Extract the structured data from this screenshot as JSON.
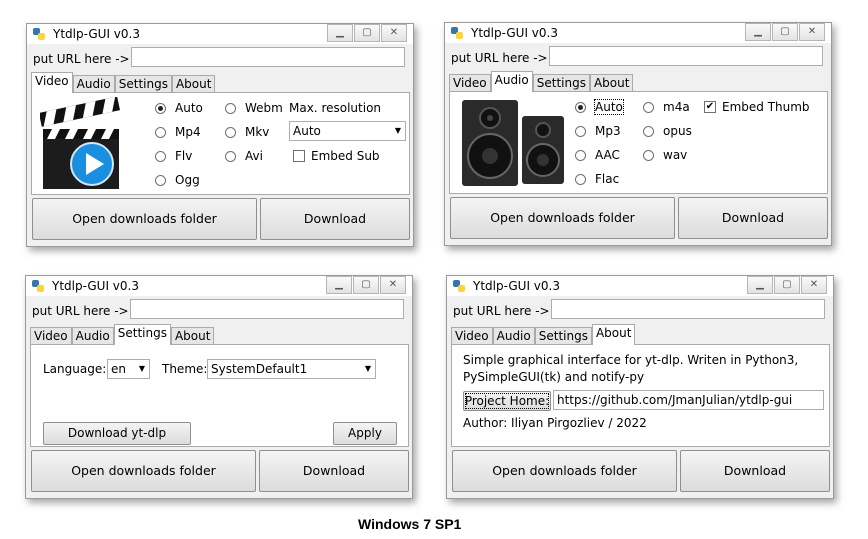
{
  "caption": "Windows 7 SP1",
  "window": {
    "title": "Ytdlp-GUI v0.3",
    "url_label": "put URL here ->",
    "url_value": "",
    "tabs": [
      "Video",
      "Audio",
      "Settings",
      "About"
    ],
    "open_folder_label": "Open downloads folder",
    "download_label": "Download"
  },
  "video": {
    "radios": [
      "Auto",
      "Mp4",
      "Flv",
      "Ogg",
      "Webm",
      "Mkv",
      "Avi"
    ],
    "selected": "Auto",
    "max_resolution_label": "Max. resolution",
    "max_resolution_value": "Auto",
    "embed_sub_label": "Embed Sub",
    "embed_sub_checked": false
  },
  "audio": {
    "radios": [
      "Auto",
      "Mp3",
      "AAC",
      "Flac",
      "m4a",
      "opus",
      "wav"
    ],
    "selected": "Auto",
    "embed_thumb_label": "Embed Thumb",
    "embed_thumb_checked": true,
    "check_mark": "✔"
  },
  "settings": {
    "language_label": "Language:",
    "language_value": "en",
    "theme_label": "Theme:",
    "theme_value": "SystemDefault1",
    "download_ytdlp_label": "Download yt-dlp",
    "apply_label": "Apply"
  },
  "about": {
    "line1": "Simple graphical interface for yt-dlp. Writen in Python3,",
    "line2": "PySimpleGUI(tk) and notify-py",
    "project_home_label": "Project Home:",
    "project_url": "https://github.com/JmanJulian/ytdlp-gui",
    "author": "Author: Iliyan Pirgozliev / 2022"
  },
  "colors": {
    "accent_blue": "#1a8fe0",
    "window_bg": "#f0f0f0"
  }
}
